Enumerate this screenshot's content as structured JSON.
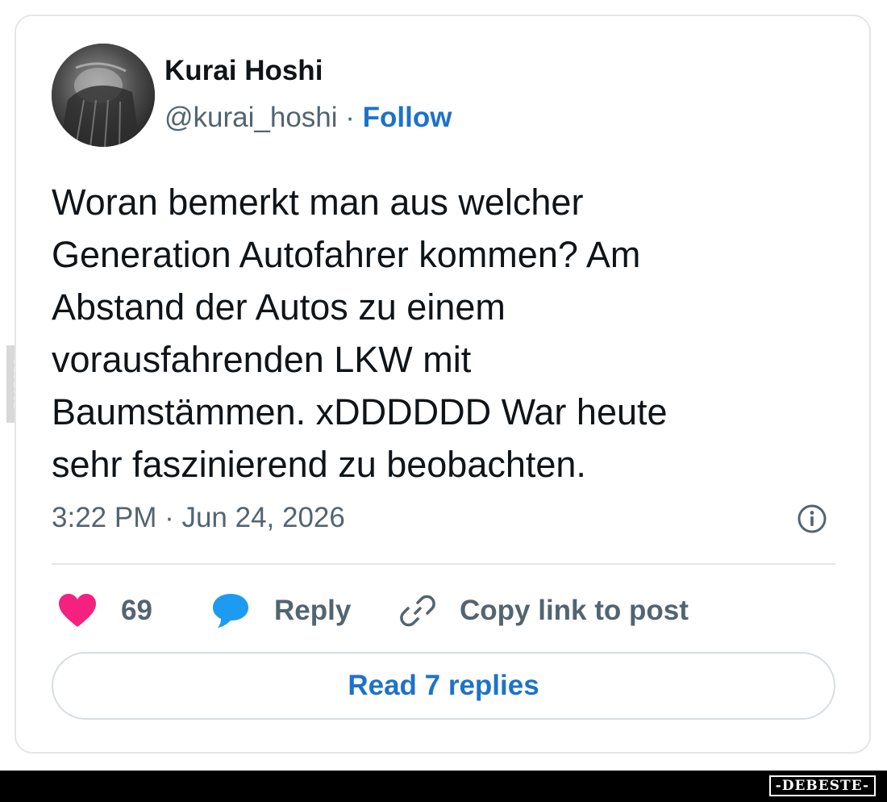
{
  "author": {
    "name": "Kurai Hoshi",
    "handle": "@kurai_hoshi",
    "separator": "·",
    "follow_label": "Follow"
  },
  "post": {
    "lines": [
      "Woran bemerkt man aus welcher",
      "Generation Autofahrer kommen? Am",
      "Abstand der Autos zu einem",
      "vorausfahrenden LKW mit",
      "Baumstämmen. xDDDDDD War heute",
      "sehr faszinierend zu beobachten."
    ],
    "timestamp": "3:22 PM · Jun 24, 2026"
  },
  "actions": {
    "like_count": "69",
    "reply_label": "Reply",
    "copy_label": "Copy link to post",
    "read_replies_label": "Read 7 replies"
  },
  "icons": {
    "like": "heart-icon",
    "reply": "speech-bubble-icon",
    "copy": "link-icon",
    "info": "info-icon"
  },
  "colors": {
    "like": "#f4217f",
    "reply": "#1d9bf0",
    "link": "#1d72c9",
    "muted": "#536471",
    "text": "#0f1419"
  },
  "watermark": {
    "side": "DEBESTE",
    "footer": "-DEBESTE-"
  }
}
